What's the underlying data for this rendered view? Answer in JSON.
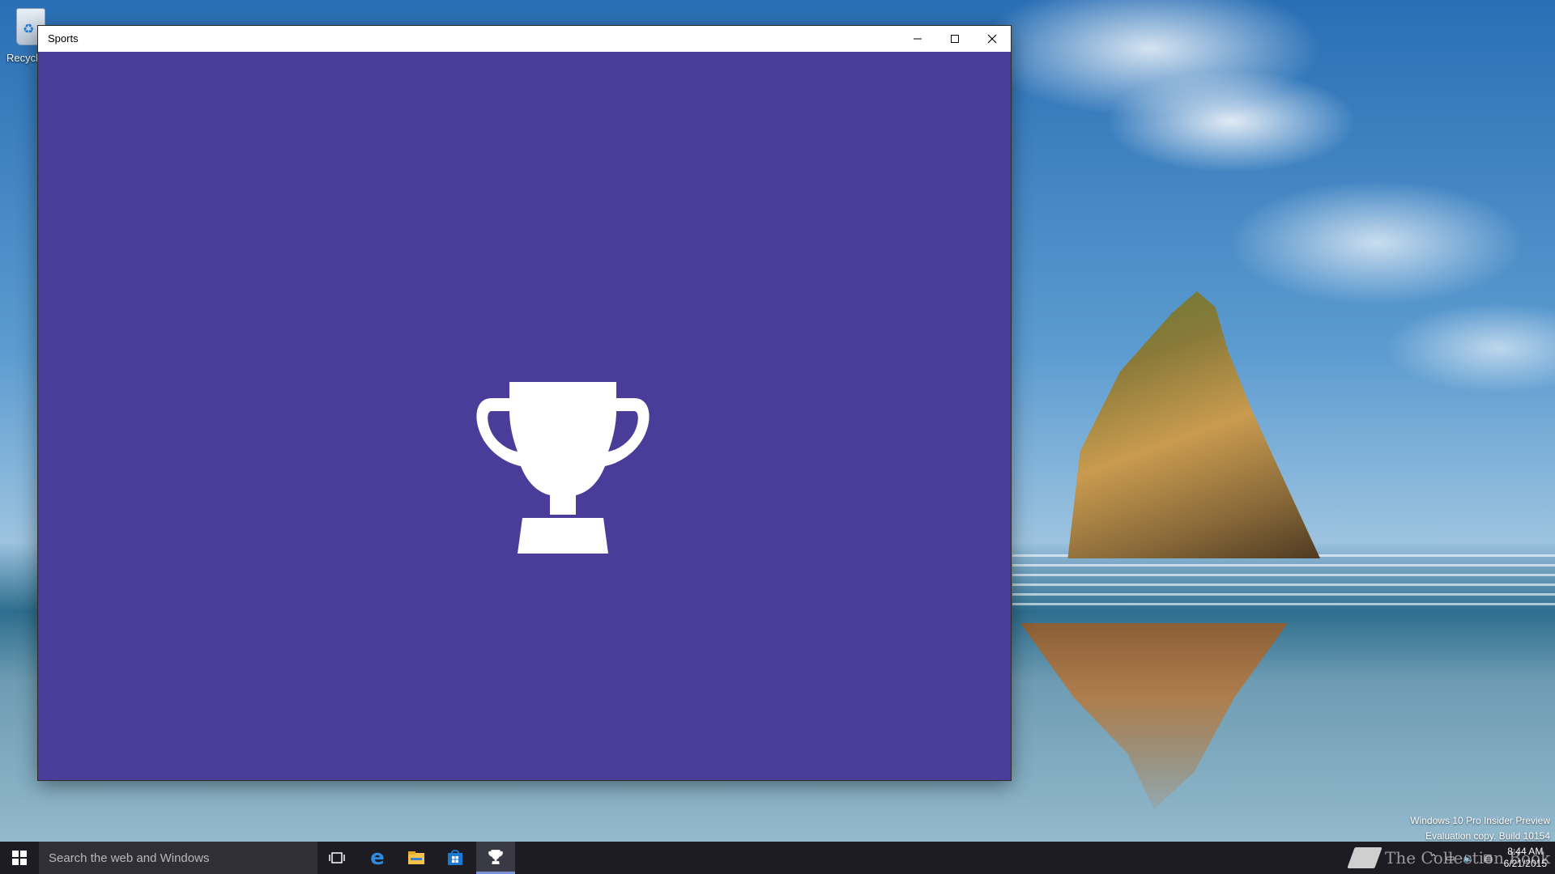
{
  "desktop": {
    "icons": [
      {
        "label": "Recycle",
        "icon": "recycle-bin-icon"
      }
    ]
  },
  "window": {
    "title": "Sports",
    "background_color": "#4a3d9a",
    "splash_icon": "trophy-icon",
    "controls": {
      "minimize": "minimize-icon",
      "maximize": "maximize-icon",
      "close": "close-icon"
    }
  },
  "watermark": {
    "line1": "Windows 10 Pro Insider Preview",
    "line2": "Evaluation copy. Build 10154"
  },
  "taskbar": {
    "search_placeholder": "Search the web and Windows",
    "apps": [
      {
        "name": "task-view",
        "icon": "task-view-icon"
      },
      {
        "name": "edge",
        "icon": "edge-icon"
      },
      {
        "name": "file-explorer",
        "icon": "folder-icon"
      },
      {
        "name": "store",
        "icon": "store-icon"
      },
      {
        "name": "sports",
        "icon": "trophy-icon",
        "active": true
      }
    ],
    "brand_text": "The Collection Book",
    "clock": {
      "time": "8:44 AM",
      "date": "6/21/2015"
    }
  }
}
